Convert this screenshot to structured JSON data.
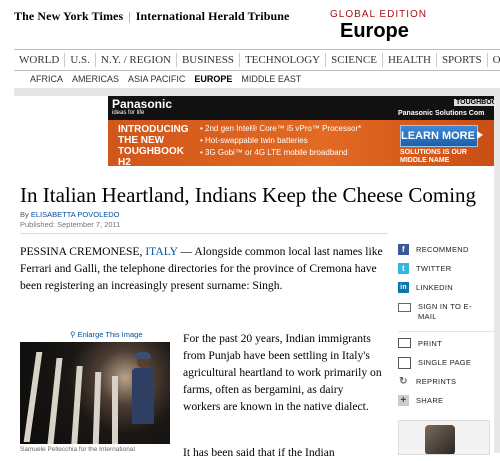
{
  "masthead": {
    "logo_nyt": "The New York Times",
    "logo_iht": "International Herald Tribune",
    "edition_label": "GLOBAL EDITION",
    "edition_region": "Europe"
  },
  "nav": {
    "items": [
      "WORLD",
      "U.S.",
      "N.Y. / REGION",
      "BUSINESS",
      "TECHNOLOGY",
      "SCIENCE",
      "HEALTH",
      "SPORTS",
      "OPINION"
    ],
    "subitems": [
      "AFRICA",
      "AMERICAS",
      "ASIA PACIFIC",
      "EUROPE",
      "MIDDLE EAST"
    ],
    "active_subitem": "EUROPE"
  },
  "ad": {
    "brand": "Panasonic",
    "tagline": "ideas for life",
    "toughbook": "TOUGHBOO",
    "solutions": "Panasonic Solutions Com",
    "intro": "INTRODUCING THE NEW TOUGHBOOK H2",
    "bullets": [
      "2nd gen Intel® Core™ i5 vPro™ Processor*",
      "Hot-swappable twin batteries",
      "3G Gobi™ or 4G LTE mobile broadband"
    ],
    "cta": "LEARN MORE",
    "footer": "SOLUTIONS IS OUR MIDDLE NAME"
  },
  "article": {
    "headline": "In Italian Heartland, Indians Keep the Cheese Coming",
    "by_prefix": "By",
    "author": "ELISABETTA POVOLEDO",
    "published": "Published: September 7, 2011",
    "dateline": "PESSINA CREMONESE,",
    "dateline_link": "ITALY",
    "lead_text": "— Alongside common local last names like Ferrari and Galli, the telephone directories for the province of Cremona have been registering an increasingly present surname: Singh.",
    "enlarge": "Enlarge This Image",
    "caption": "Samuele Pellecchia for the International",
    "para2": "For the past 20 years, Indian immigrants from Punjab have been settling in Italy's agricultural heartland to work primarily on farms, often as bergamini, as dairy workers are known in the native dialect.",
    "para3": "It has been said that if the Indian"
  },
  "tools": [
    {
      "icon": "facebook-icon",
      "label": "RECOMMEND"
    },
    {
      "icon": "twitter-icon",
      "label": "TWITTER"
    },
    {
      "icon": "linkedin-icon",
      "label": "LINKEDIN"
    },
    {
      "icon": "email-icon",
      "label": "SIGN IN TO E-MAIL"
    },
    {
      "icon": "print-icon",
      "label": "PRINT"
    },
    {
      "icon": "single-page-icon",
      "label": "SINGLE PAGE"
    },
    {
      "icon": "reprints-icon",
      "label": "REPRINTS"
    },
    {
      "icon": "share-icon",
      "label": "SHARE"
    }
  ],
  "colors": {
    "edition_red": "#a81010",
    "link_blue": "#00509e",
    "ad_orange": "#e36a22"
  }
}
